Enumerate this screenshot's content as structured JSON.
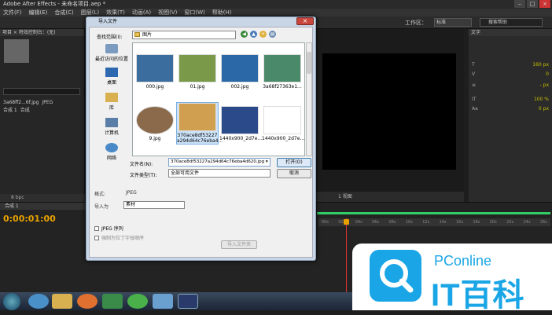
{
  "window": {
    "title": "Adobe After Effects - 未命名项目.aep *"
  },
  "menu": [
    "文件(F)",
    "编辑(E)",
    "合成(C)",
    "图层(L)",
    "效果(T)",
    "动画(A)",
    "视图(V)",
    "窗口(W)",
    "帮助(H)"
  ],
  "toolbar": {
    "workspace_label": "工作区：",
    "workspace_value": "标准",
    "help_search_placeholder": "搜索帮助"
  },
  "project_panel": {
    "title": "项目  ×  特效控制台：(无)",
    "items": [
      {
        "name": "3a68ff2...6f.jpg",
        "type": "JPEG"
      },
      {
        "name": "合成 1",
        "type": "合成"
      }
    ],
    "footer": "8 bpc"
  },
  "comp_view": {
    "footer": "1 视图"
  },
  "character_panel": {
    "title": "文字",
    "rows": [
      {
        "label": "T",
        "value": "160 px"
      },
      {
        "label": "V",
        "value": "0"
      },
      {
        "label": "≡",
        "value": "- px"
      },
      {
        "label": "IT",
        "value": "100 %"
      },
      {
        "label": "Aa",
        "value": "0 px"
      }
    ]
  },
  "timeline": {
    "tab": "合成 1",
    "timecode": "0:00:01:00",
    "ruler": [
      "00s",
      "02s",
      "04s",
      "06s",
      "08s",
      "10s",
      "12s",
      "14s",
      "16s",
      "18s",
      "20s",
      "22s",
      "24s",
      "26s"
    ]
  },
  "dialog": {
    "title": "导入文件",
    "look_in_label": "查找范围(I):",
    "look_in_value": "图片",
    "places": [
      "最近访问的位置",
      "桌面",
      "库",
      "计算机",
      "网络"
    ],
    "files": [
      {
        "name": "000.jpg",
        "color": "#3b6e9e"
      },
      {
        "name": "01.jpg",
        "color": "#7a9a4a"
      },
      {
        "name": "002.jpg",
        "color": "#2a68a8"
      },
      {
        "name": "3a68f27363e1...",
        "color": "#4a8a6a"
      },
      {
        "name": "9.jpg",
        "color": "#8a6a4a"
      },
      {
        "name": "370ace8df53227 a294d64c76eba4...",
        "color": "#d0a050"
      },
      {
        "name": "1440x900_2d7e...",
        "color": "#2a4a8a"
      },
      {
        "name": "1440x900_2d7e...",
        "color": "#ffffff"
      }
    ],
    "filename_label": "文件名(N):",
    "filename_value": "370ace8df53227a294d64c76eba4d620.jpg  ▾",
    "filetype_label": "文件类型(T):",
    "filetype_value": "全部可用文件",
    "open_label": "打开(O)",
    "cancel_label": "取消",
    "format_label": "格式:",
    "format_value": "JPEG",
    "import_as_label": "导入为",
    "import_as_value": "素材",
    "jpeg_sequence_label": "JPEG 序列",
    "force_alpha_label": "强制为位丁字母顺序",
    "import_folder_label": "导入文件夹"
  },
  "watermark": {
    "brand": "PConline",
    "text": "IT百科"
  }
}
